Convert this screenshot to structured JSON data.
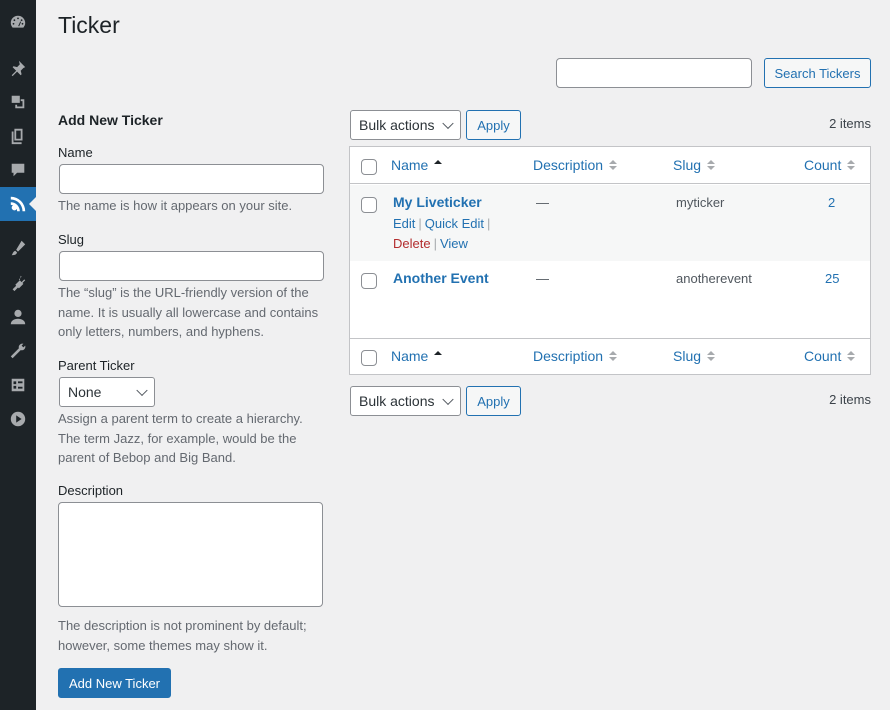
{
  "page": {
    "title": "Ticker"
  },
  "search": {
    "button_label": "Search Tickers",
    "value": ""
  },
  "form": {
    "heading": "Add New Ticker",
    "name_label": "Name",
    "name_help": "The name is how it appears on your site.",
    "slug_label": "Slug",
    "slug_help": "The “slug” is the URL-friendly version of the name. It is usually all lowercase and contains only letters, numbers, and hyphens.",
    "parent_label": "Parent Ticker",
    "parent_value": "None",
    "parent_help": "Assign a parent term to create a hierarchy. The term Jazz, for example, would be the parent of Bebop and Big Band.",
    "description_label": "Description",
    "description_help": "The description is not prominent by default; however, some themes may show it.",
    "submit_label": "Add New Ticker"
  },
  "table": {
    "bulk_actions_label": "Bulk actions",
    "apply_label": "Apply",
    "items_count": "2 items",
    "columns": {
      "name": "Name",
      "description": "Description",
      "slug": "Slug",
      "count": "Count"
    },
    "row_actions": {
      "edit": "Edit",
      "quick_edit": "Quick Edit",
      "delete": "Delete",
      "view": "View",
      "separator": "|"
    },
    "rows": [
      {
        "name": "My Liveticker",
        "description": "—",
        "slug": "myticker",
        "count": "2"
      },
      {
        "name": "Another Event",
        "description": "—",
        "slug": "anotherevent",
        "count": "25"
      }
    ]
  },
  "sidebar": {
    "icons": [
      "dashboard-icon",
      "pin-icon",
      "media-icon",
      "pages-icon",
      "comments-icon",
      "rss-icon",
      "appearance-icon",
      "plugins-icon",
      "users-icon",
      "tools-icon",
      "settings-icon",
      "play-icon"
    ],
    "active": "rss-icon"
  },
  "colors": {
    "accent": "#2271b1",
    "sidebar_bg": "#1d2327",
    "delete": "#b32d2e"
  }
}
